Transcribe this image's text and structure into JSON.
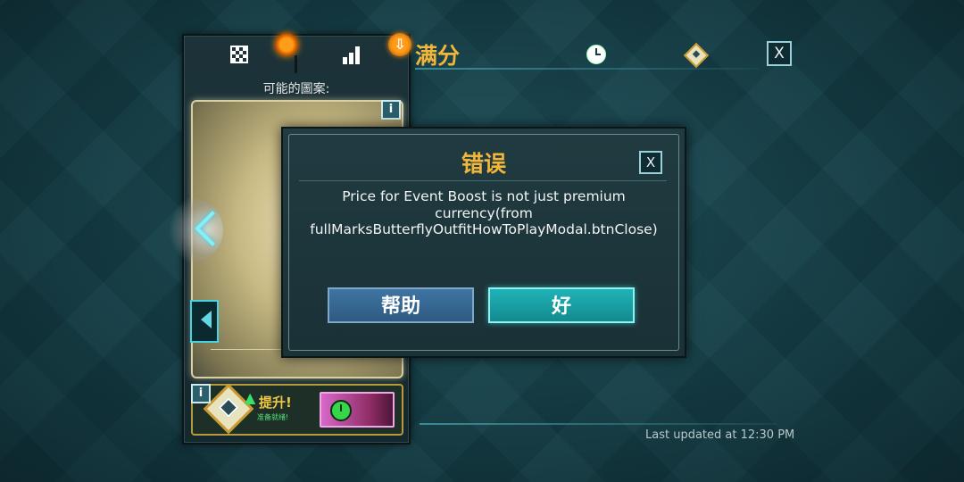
{
  "header": {
    "title": "满分",
    "close_label": "X"
  },
  "side_panel": {
    "caption": "可能的圖案:",
    "info_label": "i",
    "boost": {
      "info_label": "i",
      "title": "提升!",
      "subtitle": "准备就绪!"
    },
    "download_label": "⇩"
  },
  "modal": {
    "title": "错误",
    "close_label": "X",
    "message_lines": [
      "Price for Event Boost is not just premium",
      "currency(from",
      "fullMarksButterflyOutfitHowToPlayModal.btnClose)"
    ],
    "help_button": "帮助",
    "ok_button": "好"
  },
  "footer": {
    "last_updated": "Last updated at 12:30 PM"
  },
  "colors": {
    "accent_gold": "#f2b73a",
    "teal_button": "#1fb3b6",
    "blue_button": "#3f75a2"
  }
}
